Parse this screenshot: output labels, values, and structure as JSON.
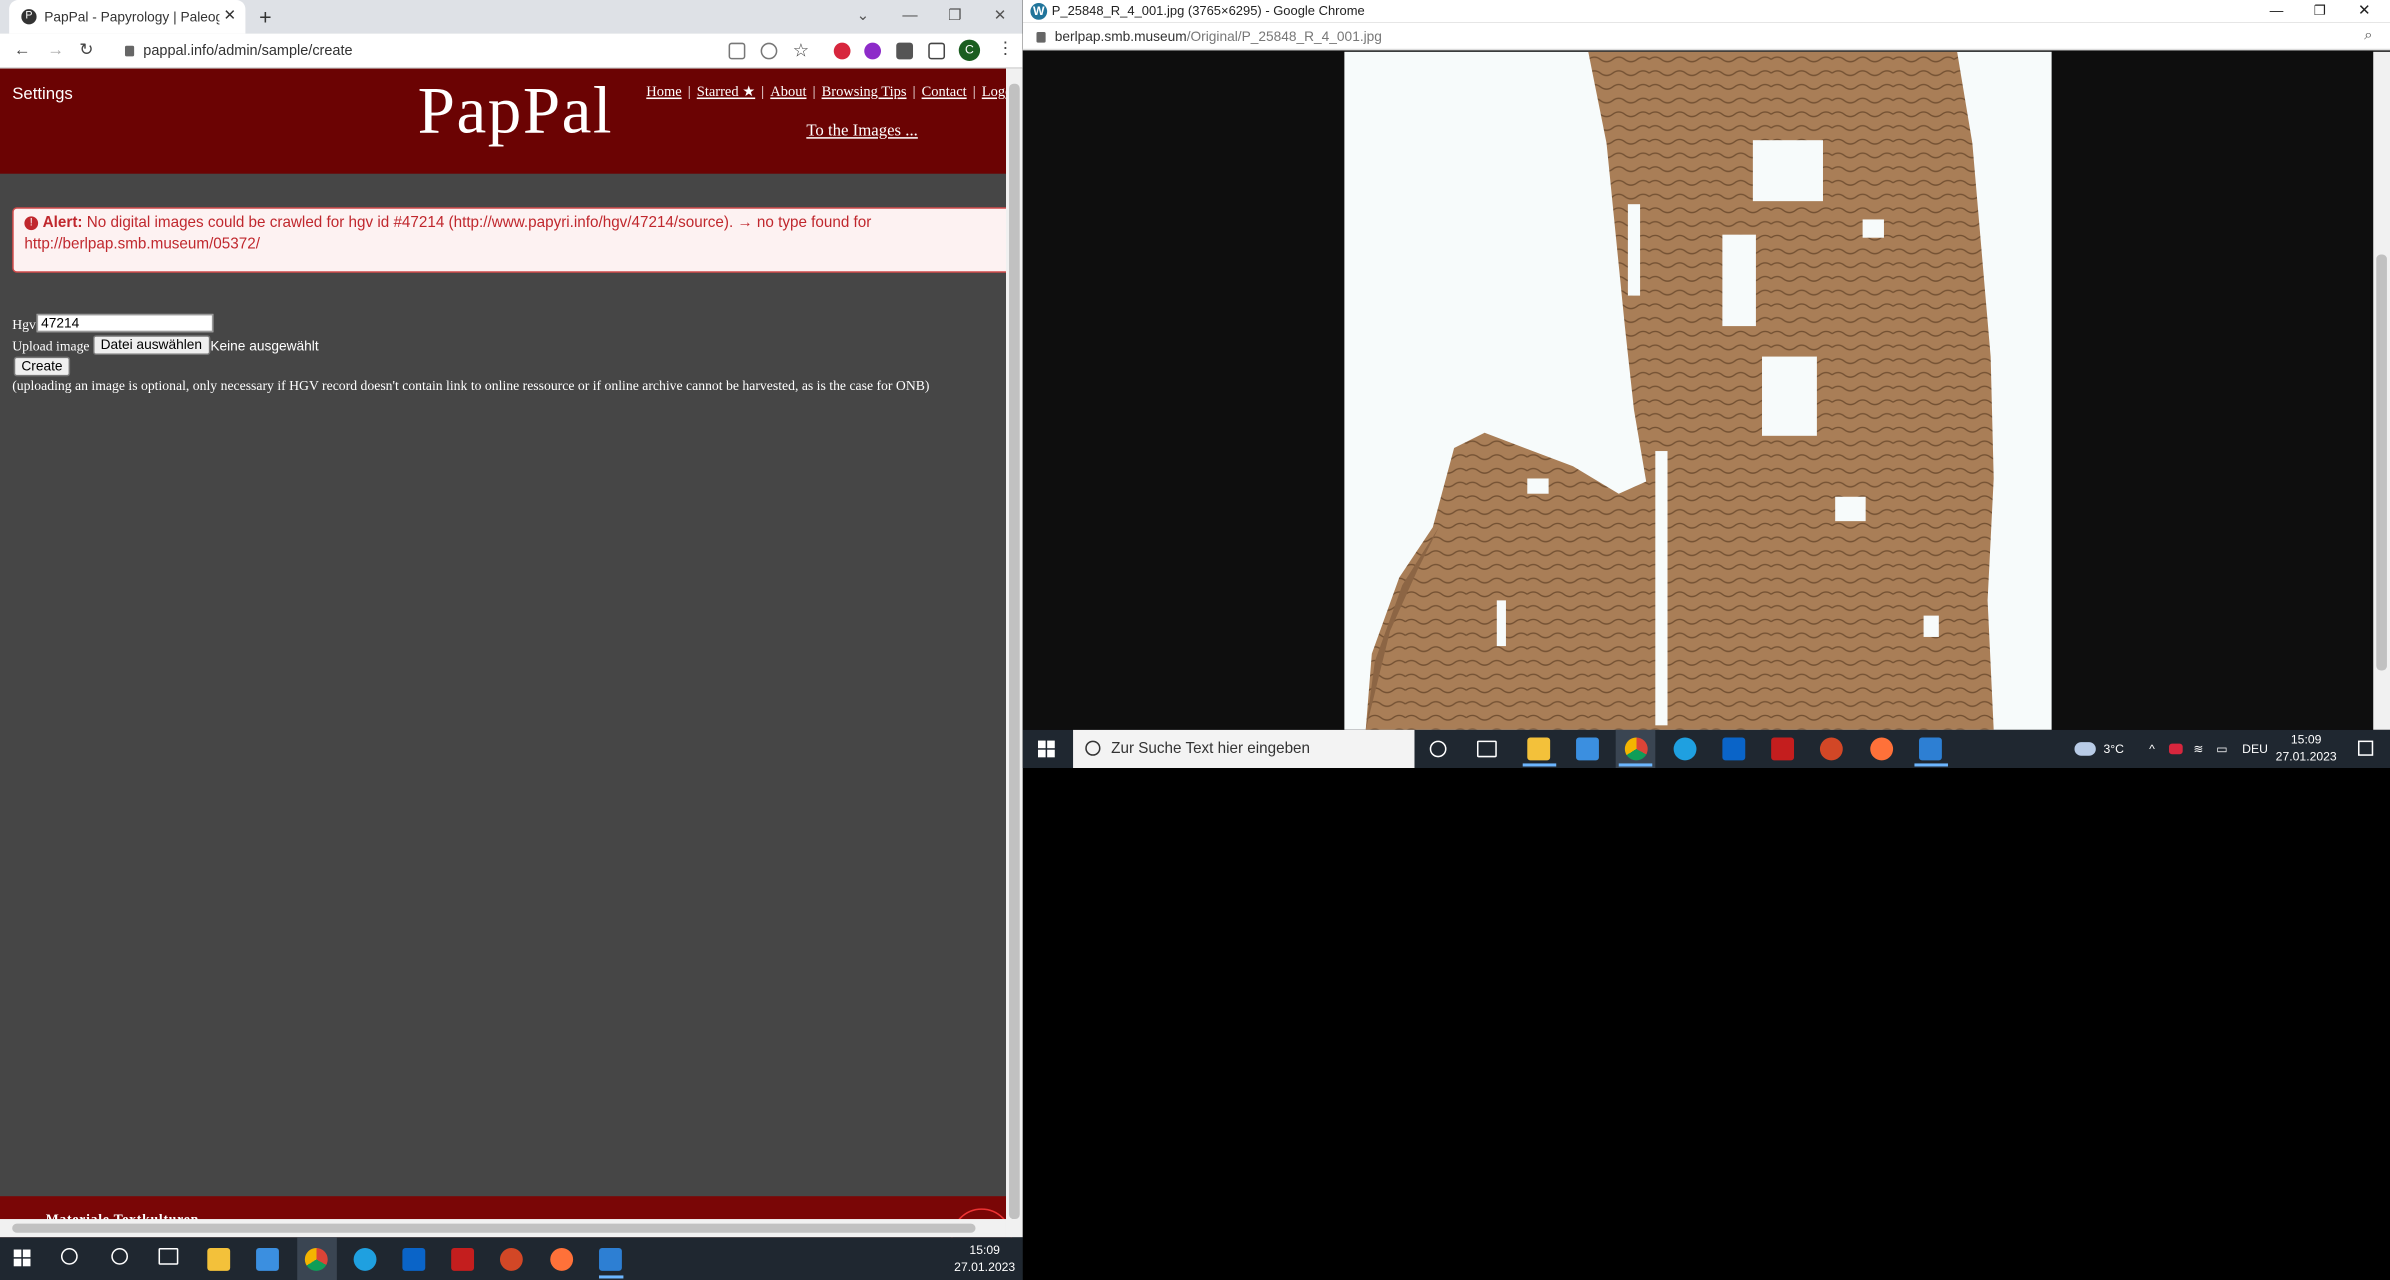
{
  "left_window": {
    "tab_title": "PapPal - Papyrology | Paleograph",
    "url": "pappal.info/admin/sample/create",
    "header": {
      "settings": "Settings",
      "logo": "PapPal",
      "menu": [
        "Home",
        "Starred ★",
        "About",
        "Browsing Tips",
        "Contact",
        "Logou"
      ],
      "to_images": "To the Images ..."
    },
    "alert": {
      "label": "Alert:",
      "message": "No digital images could be crawled for hgv id #47214 (http://www.papyri.info/hgv/47214/source). → no type found for",
      "message2": "http://berlpap.smb.museum/05372/"
    },
    "form": {
      "hgv_label": "Hgv",
      "hgv_value": "47214",
      "upload_label": "Upload image",
      "file_button": "Datei auswählen",
      "no_file": "Keine ausgewählt",
      "create_button": "Create",
      "note": "(uploading an image is optional, only necessary if HGV record doesn't contain link to online ressource or if online archive cannot be harvested, as is the case for ONB)"
    },
    "footer": "Materiale Textkulturen"
  },
  "right_window": {
    "title": "P_25848_R_4_001.jpg (3765×6295) - Google Chrome",
    "url_host": "berlpap.smb.museum",
    "url_path": "/Original/P_25848_R_4_001.jpg"
  },
  "right_taskbar": {
    "search_placeholder": "Zur Suche Text hier eingeben",
    "weather": "3°C",
    "language": "DEU",
    "time": "15:09",
    "date": "27.01.2023"
  },
  "left_taskbar": {
    "time": "15:09",
    "date": "27.01.2023"
  },
  "colors": {
    "header_bg": "#6b0303",
    "page_bg": "#464646",
    "alert_text": "#c0272d",
    "papyrus": "#a87d55"
  }
}
